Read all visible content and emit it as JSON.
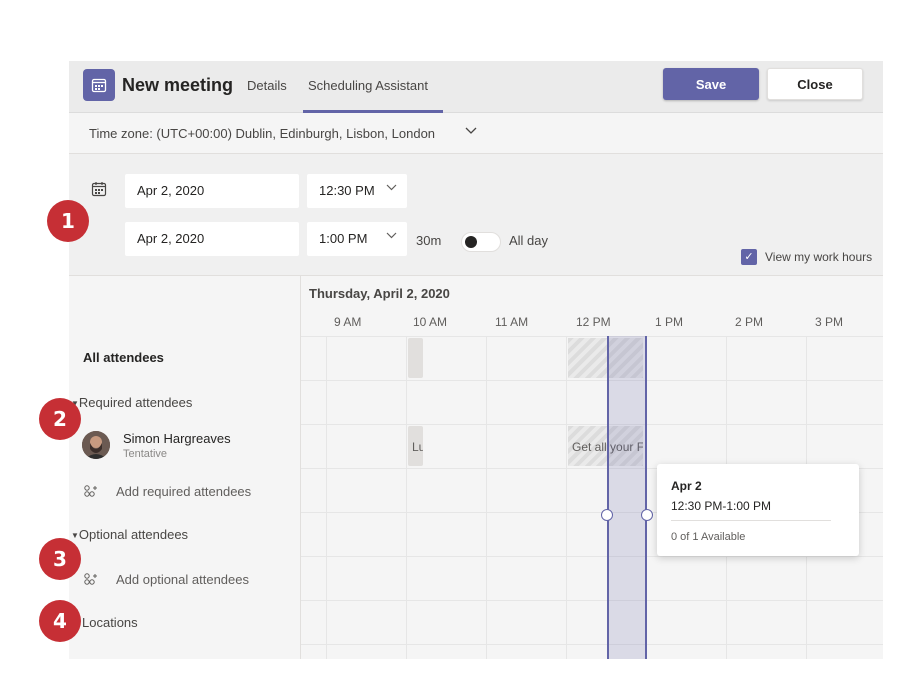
{
  "header": {
    "title": "New meeting",
    "tabs": [
      {
        "label": "Details"
      },
      {
        "label": "Scheduling Assistant"
      }
    ],
    "save_label": "Save",
    "close_label": "Close"
  },
  "timezone": {
    "label": "Time zone: (UTC+00:00) Dublin, Edinburgh, Lisbon, London",
    "chevron": "∨"
  },
  "schedule": {
    "start_date": "Apr 2, 2020",
    "start_time": "12:30 PM",
    "end_date": "Apr 2, 2020",
    "end_time": "1:00 PM",
    "duration": "30m",
    "all_day_label": "All day",
    "all_day_on": false,
    "view_work_hours_label": "View my work hours",
    "view_work_hours_checked": true
  },
  "attendees": {
    "all_label": "All attendees",
    "required_label": "Required attendees",
    "optional_label": "Optional attendees",
    "locations_label": "Locations",
    "add_required_label": "Add required attendees",
    "add_optional_label": "Add optional attendees",
    "people": [
      {
        "name": "Simon Hargreaves",
        "status": "Tentative"
      }
    ]
  },
  "timeline": {
    "day_label": "Thursday, April 2, 2020",
    "hours": [
      "9 AM",
      "10 AM",
      "11 AM",
      "12 PM",
      "1 PM",
      "2 PM",
      "3 PM"
    ],
    "events": [
      {
        "label": "Lu",
        "row": "person"
      },
      {
        "label": "Get all your F",
        "row": "person"
      }
    ]
  },
  "tooltip": {
    "date": "Apr 2",
    "time_range": "12:30 PM-1:00 PM",
    "availability": "0 of 1 Available"
  },
  "badges": [
    "1",
    "2",
    "3",
    "4"
  ],
  "colors": {
    "accent": "#6264a7",
    "badge": "#c62f35"
  },
  "icons": [
    "calendar-icon",
    "add-people-icon",
    "caret-down-icon",
    "chevron-down-icon",
    "checkbox-icon"
  ]
}
